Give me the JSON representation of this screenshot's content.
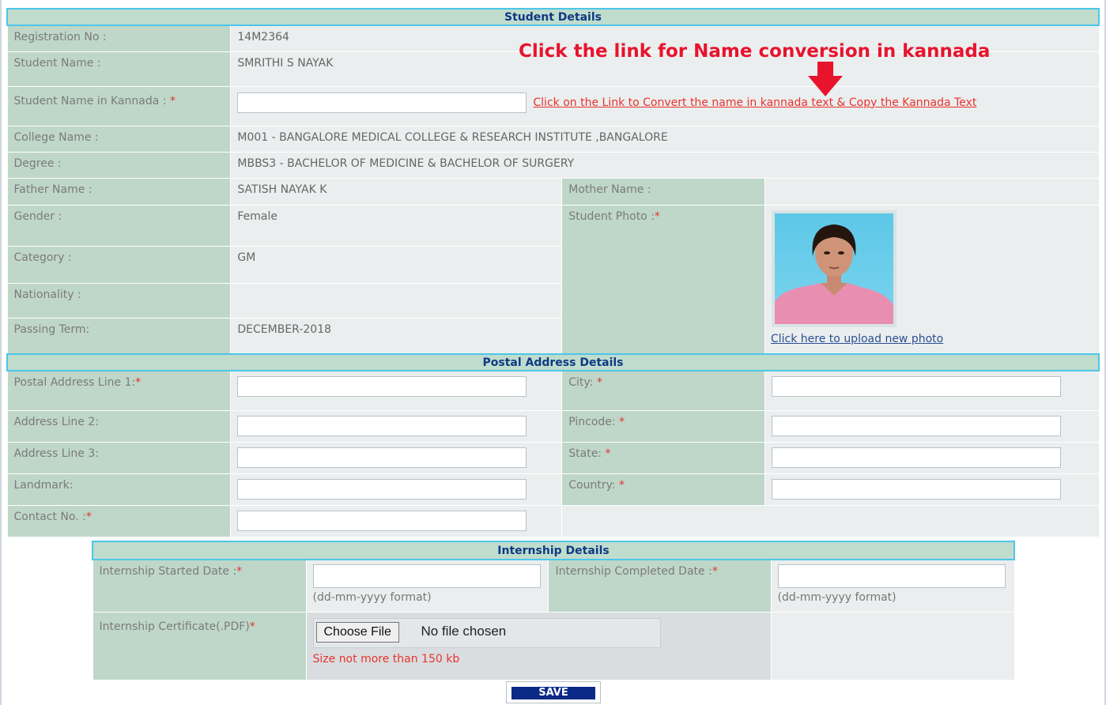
{
  "student_details": {
    "header": "Student Details",
    "registration_label": "Registration No :",
    "registration_value": "14M2364",
    "name_label": "Student Name :",
    "name_value": "SMRITHI S NAYAK",
    "kannada_label": "Student Name in Kannada : ",
    "kannada_value": "",
    "kannada_link": "Click on the Link to Convert the name in kannada text & Copy the Kannada Text",
    "college_label": "College Name :",
    "college_value": "M001 - BANGALORE MEDICAL COLLEGE & RESEARCH INSTITUTE ,BANGALORE",
    "degree_label": "Degree :",
    "degree_value": "MBBS3 - BACHELOR OF MEDICINE & BACHELOR OF SURGERY",
    "father_label": "Father Name :",
    "father_value": "SATISH NAYAK K",
    "mother_label": "Mother Name :",
    "mother_value": "",
    "gender_label": "Gender :",
    "gender_value": "Female",
    "photo_label": "Student Photo :",
    "category_label": "Category :",
    "category_value": "GM",
    "nationality_label": "Nationality :",
    "nationality_value": "",
    "passing_label": "Passing Term:",
    "passing_value": "DECEMBER-2018",
    "upload_link": "Click here to upload new photo",
    "required_mark": "*"
  },
  "annotation": {
    "text": "Click the link for Name conversion in  kannada"
  },
  "postal_details": {
    "header": "Postal Address Details",
    "line1_label": "Postal Address Line 1:",
    "line2_label": "Address Line 2:",
    "line3_label": "Address Line 3:",
    "landmark_label": "Landmark:",
    "contact_label": "Contact No. :",
    "city_label": "City: ",
    "pincode_label": "Pincode: ",
    "state_label": "State: ",
    "country_label": "Country: "
  },
  "internship_details": {
    "header": "Internship Details",
    "started_label": "Internship Started Date :",
    "completed_label": "Internship Completed Date :",
    "date_format": "(dd-mm-yyyy format)",
    "certificate_label": "Internship Certificate(.PDF)",
    "choose_button": "Choose File",
    "no_file": "No file chosen",
    "size_note": "Size not more than 150 kb"
  },
  "save_button": "SAVE",
  "colors": {
    "header_text": "#0f3a83",
    "header_border": "#4cc6ea",
    "label_bg": "#bfd7c8",
    "value_bg": "#ebeeee",
    "required": "#e23232",
    "link_red": "#e8332d",
    "save_bg": "#0b2a88"
  }
}
